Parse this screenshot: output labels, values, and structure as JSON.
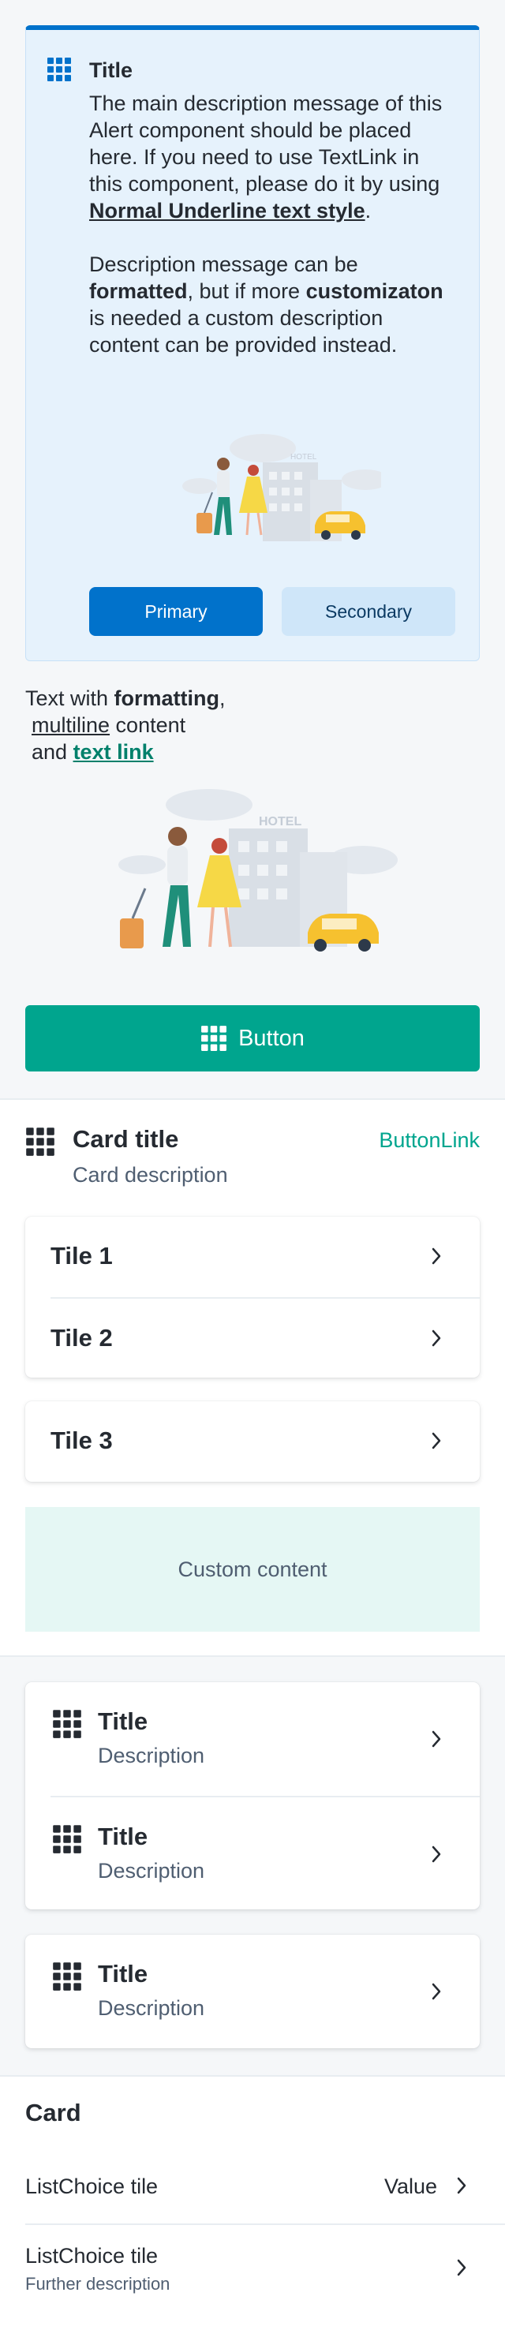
{
  "alert": {
    "title": "Title",
    "desc1_a": "The main description message of this Alert component should be placed here. If you need to use TextLink in this component, please do it by using ",
    "desc1_link": "Normal Underline text style",
    "desc1_b": ".",
    "desc2_a": "Description message can be ",
    "desc2_b1": "formatted",
    "desc2_c": ", but if more ",
    "desc2_b2": "customizaton",
    "desc2_d": " is needed a custom description content can be provided instead.",
    "illustration_sign": "HOTEL",
    "primary_label": "Primary",
    "secondary_label": "Secondary"
  },
  "rich_text": {
    "a": "Text with ",
    "bold": "formatting",
    "b": ",",
    "underline": "multiline",
    "c": " content",
    "d": "and ",
    "link": "text link"
  },
  "illustration2_sign": "HOTEL",
  "main_button_label": "Button",
  "card": {
    "title": "Card title",
    "description": "Card description",
    "button_link": "ButtonLink",
    "tiles": [
      "Tile 1",
      "Tile 2",
      "Tile 3"
    ],
    "custom_content": "Custom content"
  },
  "icon_tiles": [
    {
      "title": "Title",
      "description": "Description"
    },
    {
      "title": "Title",
      "description": "Description"
    },
    {
      "title": "Title",
      "description": "Description"
    }
  ],
  "listchoice_card": {
    "title": "Card",
    "item1_label": "ListChoice tile",
    "item1_value": "Value",
    "item2_label": "ListChoice tile",
    "item2_description": "Further description"
  },
  "colors": {
    "alert_accent": "#0172cb",
    "primary_green": "#00a58e",
    "link_green": "#00806b"
  }
}
